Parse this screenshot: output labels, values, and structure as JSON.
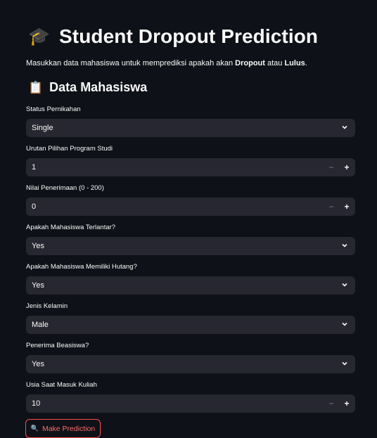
{
  "header": {
    "title_icon": "graduation-cap-icon",
    "title": "Student Dropout Prediction",
    "intro_prefix": "Masukkan data mahasiswa untuk memprediksi apakah akan ",
    "intro_dropout": "Dropout",
    "intro_mid": " atau ",
    "intro_lulus": "Lulus",
    "intro_suffix": "."
  },
  "section": {
    "icon": "clipboard-icon",
    "title": "Data Mahasiswa"
  },
  "fields": {
    "status": {
      "label": "Status Pernikahan",
      "value": "Single"
    },
    "urutan": {
      "label": "Urutan Pilihan Program Studi",
      "value": "1"
    },
    "nilai": {
      "label": "Nilai Penerimaan (0 - 200)",
      "value": "0"
    },
    "terlantar": {
      "label": "Apakah Mahasiswa Terlantar?",
      "value": "Yes"
    },
    "hutang": {
      "label": "Apakah Mahasiswa Memiliki Hutang?",
      "value": "Yes"
    },
    "gender": {
      "label": "Jenis Kelamin",
      "value": "Male"
    },
    "beasiswa": {
      "label": "Penerima Beasiswa?",
      "value": "Yes"
    },
    "usia": {
      "label": "Usia Saat Masuk Kuliah",
      "value": "10"
    }
  },
  "stepper": {
    "minus": "−",
    "plus": "+"
  },
  "action": {
    "icon": "magnifier-icon",
    "label": "Make Prediction"
  },
  "colors": {
    "background": "#0e1117",
    "input_bg": "#262730",
    "accent": "#ff4b4b"
  }
}
